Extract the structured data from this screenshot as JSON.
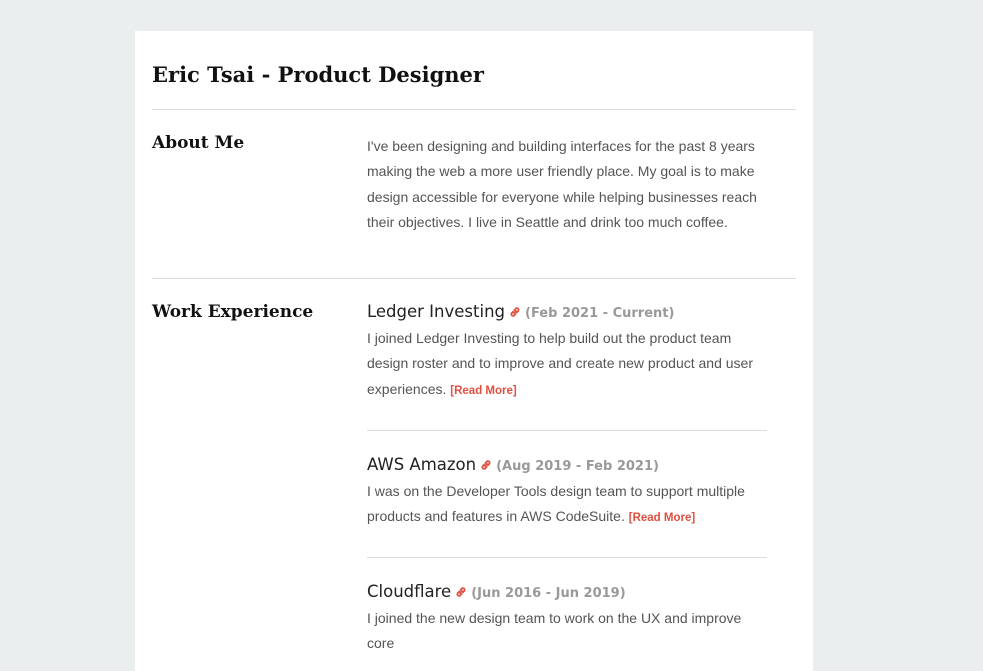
{
  "header": {
    "title": "Eric Tsai - Product Designer"
  },
  "about": {
    "heading": "About Me",
    "text": "I've been designing and building interfaces for the past 8 years making the web a more user friendly place. My goal is to make design accessible for everyone while helping businesses reach their objectives. I live in Seattle and drink too much coffee."
  },
  "work": {
    "heading": "Work Experience",
    "read_more_label": "[Read More]",
    "jobs": [
      {
        "company": "Ledger Investing",
        "dates": "(Feb 2021 - Current)",
        "description": "I joined Ledger Investing to help build out the product team design roster and to improve and create new product and user experiences.",
        "icon": "link-icon"
      },
      {
        "company": "AWS Amazon",
        "dates": "(Aug 2019 - Feb 2021)",
        "description": "I was on the Developer Tools design team to support multiple products and features in AWS CodeSuite.",
        "icon": "link-icon"
      },
      {
        "company": "Cloudflare",
        "dates": "(Jun 2016 - Jun 2019)",
        "description": "I joined the new design team to work on the UX and improve core",
        "icon": "link-icon"
      }
    ]
  },
  "colors": {
    "background": "#ebeeef",
    "card": "#ffffff",
    "accent": "#e05040",
    "muted": "#999999"
  }
}
